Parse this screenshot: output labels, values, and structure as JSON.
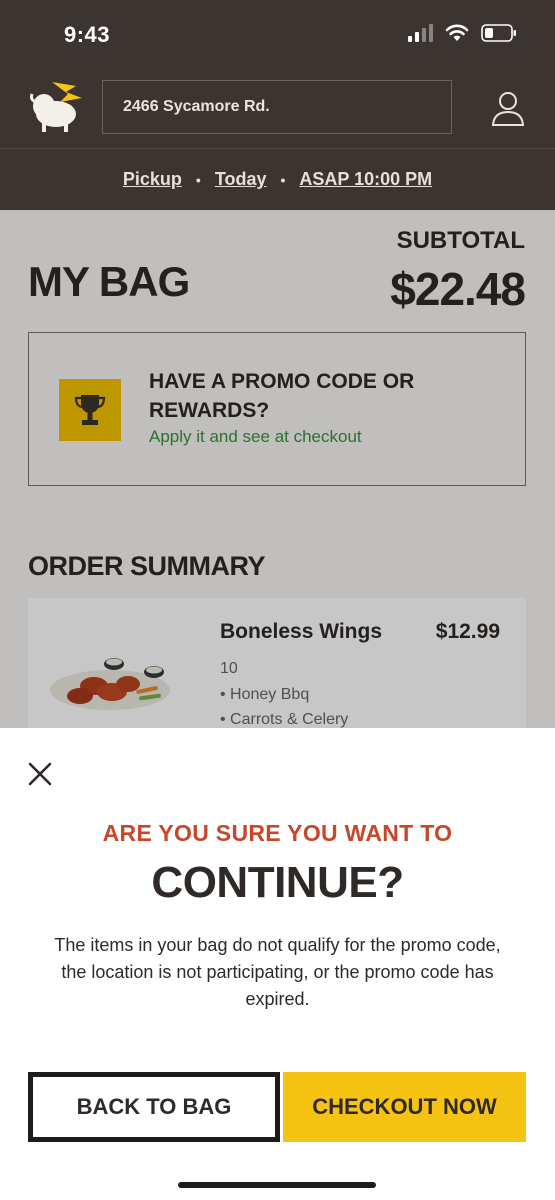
{
  "status_bar": {
    "time": "9:43"
  },
  "header": {
    "address": "2466 Sycamore Rd.",
    "logo_icon": "buffalo-logo-icon",
    "profile_icon": "user-profile-icon"
  },
  "order_options": {
    "mode": "Pickup",
    "day": "Today",
    "time": "ASAP 10:00 PM",
    "separator": "•"
  },
  "bag": {
    "title": "MY BAG",
    "subtotal_label": "SUBTOTAL",
    "subtotal_value": "$22.48"
  },
  "promo": {
    "title": "HAVE A PROMO CODE OR REWARDS?",
    "subtitle": "Apply it and see at checkout",
    "icon": "trophy-icon"
  },
  "order_summary": {
    "title": "ORDER SUMMARY",
    "items": [
      {
        "name": "Boneless Wings",
        "price": "$12.99",
        "quantity": "10",
        "modifiers": [
          "• Honey Bbq",
          "• Carrots & Celery"
        ]
      }
    ]
  },
  "modal": {
    "pre_title": "ARE YOU SURE YOU WANT TO",
    "title": "CONTINUE?",
    "body": "The items in your bag do not qualify for the promo code, the location is not participating, or the promo code has expired.",
    "back_label": "BACK TO BAG",
    "checkout_label": "CHECKOUT NOW"
  },
  "colors": {
    "header_bg": "#3c3430",
    "accent_yellow": "#f7c313",
    "accent_red": "#c8462a",
    "promo_green": "#3b8f3b"
  }
}
